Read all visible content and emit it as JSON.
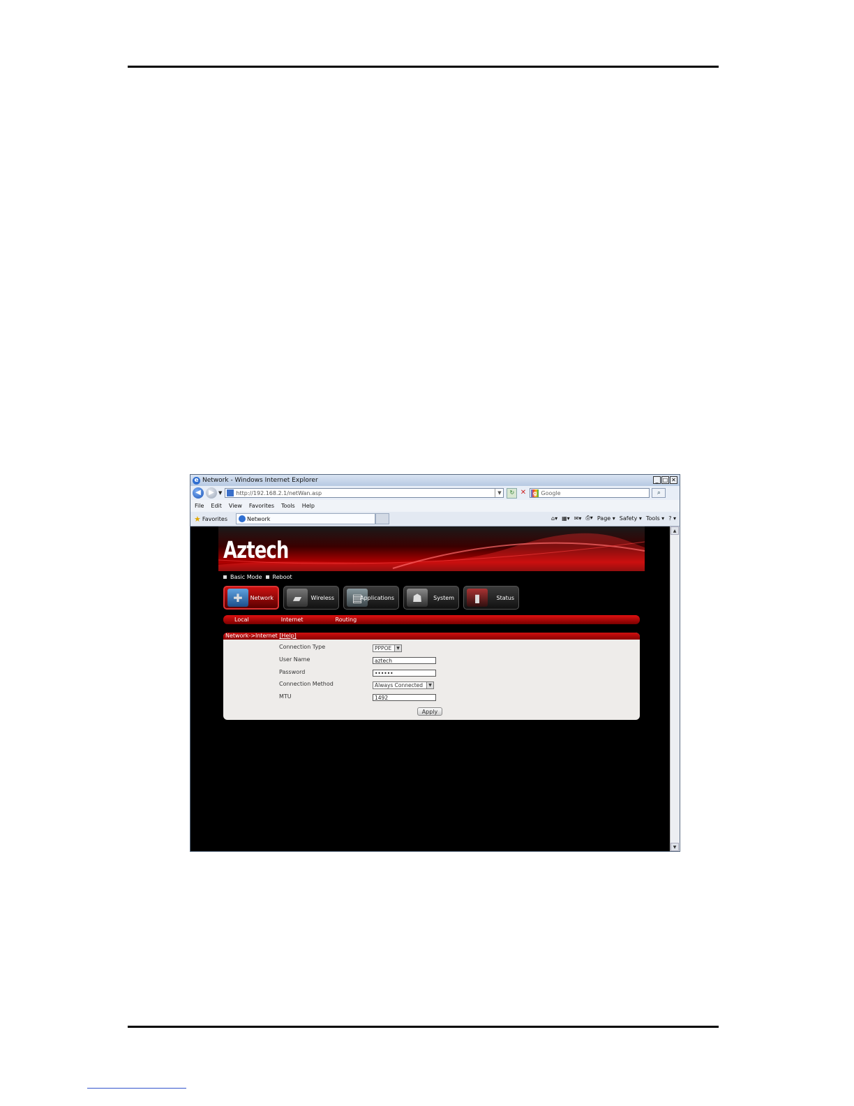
{
  "browser": {
    "title": "Network - Windows Internet Explorer",
    "url": "http://192.168.2.1/netWan.asp",
    "search_placeholder": "Google",
    "menu": [
      "File",
      "Edit",
      "View",
      "Favorites",
      "Tools",
      "Help"
    ],
    "favorites_label": "Favorites",
    "tab_label": "Network",
    "commands": [
      "Page ▾",
      "Safety ▾",
      "Tools ▾",
      "? ▾"
    ]
  },
  "router": {
    "logo": "Aztech",
    "top_links": [
      "Basic Mode",
      "Reboot"
    ],
    "main_tabs": [
      {
        "label": "Network",
        "active": true
      },
      {
        "label": "Wireless",
        "active": false
      },
      {
        "label": "Applications",
        "active": false
      },
      {
        "label": "System",
        "active": false
      },
      {
        "label": "Status",
        "active": false
      }
    ],
    "sub_tabs": [
      "Local",
      "Internet",
      "Routing"
    ],
    "breadcrumb": "Network->Internet",
    "help_link": "[Help]",
    "form": {
      "connection_type_label": "Connection Type",
      "connection_type_value": "PPPOE",
      "user_name_label": "User Name",
      "user_name_value": "aztech",
      "password_label": "Password",
      "password_value": "••••••",
      "connection_method_label": "Connection Method",
      "connection_method_value": "Always Connected",
      "mtu_label": "MTU",
      "mtu_value": "1492",
      "apply_label": "Apply"
    }
  },
  "colors": {
    "accent_red": "#c00000",
    "page_background": "#000000",
    "panel_background": "#eeecea"
  }
}
